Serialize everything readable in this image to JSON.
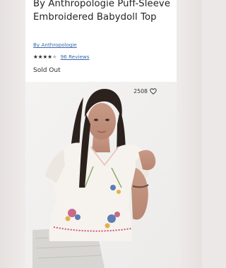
{
  "product": {
    "title": "By Anthropologie Puff-Sleeve Embroidered Babydoll Top",
    "brand": "By Anthropologie",
    "rating": {
      "stars": 4.5,
      "out_of": 5,
      "reviews_label": "96 Reviews"
    },
    "status": "Sold Out",
    "favorites_count": "2508"
  },
  "colors": {
    "link": "#3a6aa8",
    "text": "#232323",
    "backdrop": "#ece8e7"
  },
  "icons": {
    "star": "star-icon",
    "heart": "heart-outline-icon"
  }
}
